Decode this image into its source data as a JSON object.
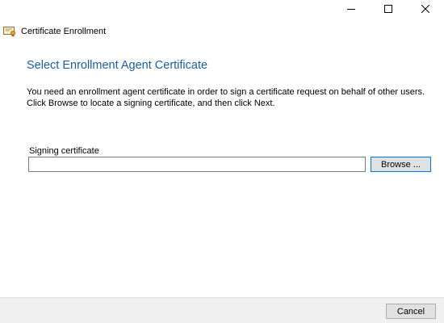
{
  "window": {
    "title": "Certificate Enrollment",
    "controls": [
      "minimize-icon",
      "maximize-icon",
      "close-icon"
    ]
  },
  "page": {
    "heading": "Select Enrollment Agent Certificate",
    "description": "You need an enrollment agent certificate in order to sign a certificate request on behalf of other users. Click Browse to locate a signing certificate, and then click Next.",
    "signing_label": "Signing certificate",
    "signing_value": "",
    "browse_label": "Browse ..."
  },
  "footer": {
    "cancel_label": "Cancel"
  },
  "colors": {
    "heading": "#1a5fa8",
    "focus_border": "#0078d7",
    "footer_bg": "#f0f0f0"
  }
}
